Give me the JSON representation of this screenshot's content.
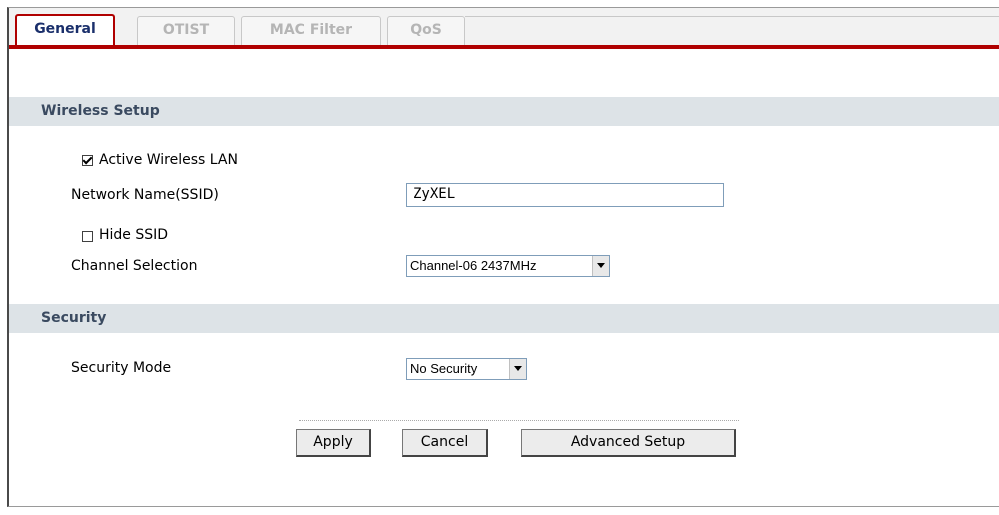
{
  "tabs": [
    {
      "label": "General",
      "active": true
    },
    {
      "label": "OTIST",
      "active": false
    },
    {
      "label": "MAC Filter",
      "active": false
    },
    {
      "label": "QoS",
      "active": false
    }
  ],
  "wireless_setup": {
    "title": "Wireless Setup",
    "active_wlan_label": "Active Wireless LAN",
    "active_wlan_checked": true,
    "ssid_label": "Network Name(SSID)",
    "ssid_value": "ZyXEL",
    "hide_ssid_label": "Hide SSID",
    "hide_ssid_checked": false,
    "channel_label": "Channel Selection",
    "channel_value": "Channel-06 2437MHz"
  },
  "security": {
    "title": "Security",
    "mode_label": "Security Mode",
    "mode_value": "No Security"
  },
  "buttons": {
    "apply": "Apply",
    "cancel": "Cancel",
    "advanced": "Advanced Setup"
  },
  "colors": {
    "accent_red": "#b00000",
    "section_bg": "#dde3e7",
    "active_tab_text": "#1a2f6b"
  }
}
